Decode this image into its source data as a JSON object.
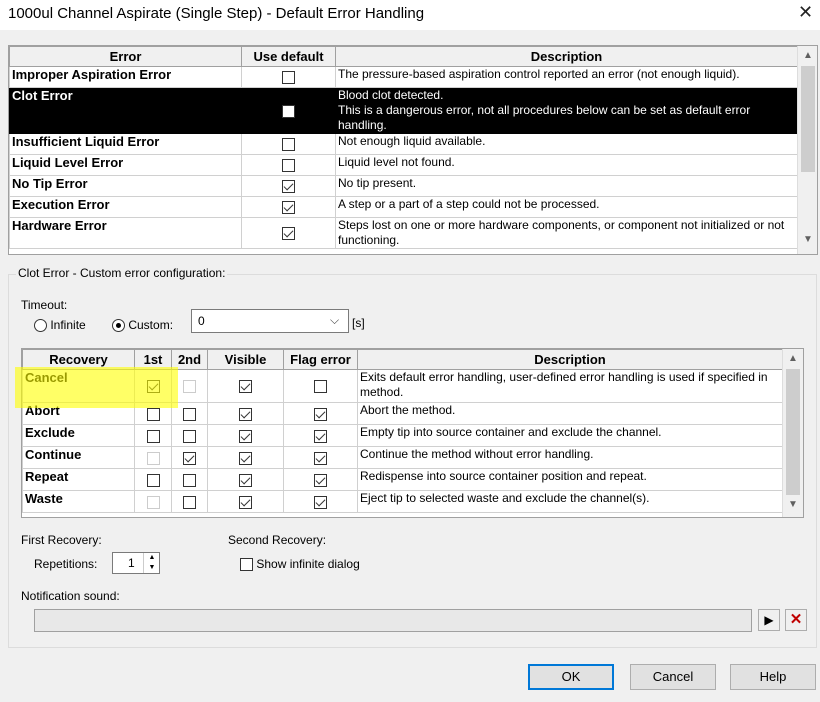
{
  "window": {
    "title": "1000ul Channel Aspirate (Single Step) - Default Error Handling",
    "close_glyph": "✕"
  },
  "errors": {
    "headers": {
      "error": "Error",
      "use_default": "Use default",
      "description": "Description"
    },
    "rows": [
      {
        "name": "Improper Aspiration Error",
        "use_default": false,
        "description": "The pressure-based aspiration control reported an error (not enough liquid).",
        "selected": false
      },
      {
        "name": "Clot Error",
        "use_default": false,
        "description": "Blood clot detected.\nThis is a dangerous error, not all procedures below can be set as default error handling.",
        "selected": true
      },
      {
        "name": "Insufficient Liquid Error",
        "use_default": false,
        "description": "Not enough liquid available.",
        "selected": false
      },
      {
        "name": "Liquid Level Error",
        "use_default": false,
        "description": "Liquid level not found.",
        "selected": false
      },
      {
        "name": "No Tip Error",
        "use_default": true,
        "description": "No tip present.",
        "selected": false
      },
      {
        "name": "Execution Error",
        "use_default": true,
        "description": "A step or a part of a step could not be processed.",
        "selected": false
      },
      {
        "name": "Hardware Error",
        "use_default": true,
        "description": "Steps lost on one or more hardware components, or component not initialized or not functioning.",
        "selected": false
      }
    ]
  },
  "custom": {
    "group_title": "Clot Error - Custom error configuration:",
    "timeout_label": "Timeout:",
    "infinite_label": "Infinite",
    "custom_label": "Custom:",
    "timeout_value": "0",
    "timeout_unit": "[s]",
    "timeout_mode": "custom"
  },
  "recovery": {
    "headers": {
      "recovery": "Recovery",
      "first": "1st",
      "second": "2nd",
      "visible": "Visible",
      "flag": "Flag error",
      "description": "Description"
    },
    "rows": [
      {
        "name": "Cancel",
        "first": "on",
        "second": "disabled",
        "visible": true,
        "flag": false,
        "description": "Exits default error handling, user-defined error handling is used if specified in method.",
        "highlight": true
      },
      {
        "name": "Abort",
        "first": "off",
        "second": "off",
        "visible": true,
        "flag": true,
        "description": "Abort the method."
      },
      {
        "name": "Exclude",
        "first": "off",
        "second": "off",
        "visible": true,
        "flag": true,
        "description": "Empty tip into source container and exclude the channel."
      },
      {
        "name": "Continue",
        "first": "disabled",
        "second": "on",
        "visible": true,
        "flag": true,
        "description": "Continue the method without error handling."
      },
      {
        "name": "Repeat",
        "first": "off",
        "second": "off",
        "visible": true,
        "flag": true,
        "description": "Redispense into source container position and repeat."
      },
      {
        "name": "Waste",
        "first": "disabled",
        "second": "off",
        "visible": true,
        "flag": true,
        "description": "Eject tip to selected waste and exclude the channel(s)."
      }
    ],
    "highlight_color": "#ffff00"
  },
  "first_recovery": {
    "label": "First Recovery:",
    "repetitions_label": "Repetitions:",
    "repetitions_value": "1"
  },
  "second_recovery": {
    "label": "Second Recovery:",
    "show_infinite_label": "Show infinite dialog",
    "show_infinite": false
  },
  "notification": {
    "label": "Notification sound:",
    "value": ""
  },
  "buttons": {
    "ok": "OK",
    "cancel": "Cancel",
    "help": "Help"
  },
  "colors": {
    "selection": "#000000",
    "accent": "#0078d7",
    "delete_icon": "#c00000"
  }
}
